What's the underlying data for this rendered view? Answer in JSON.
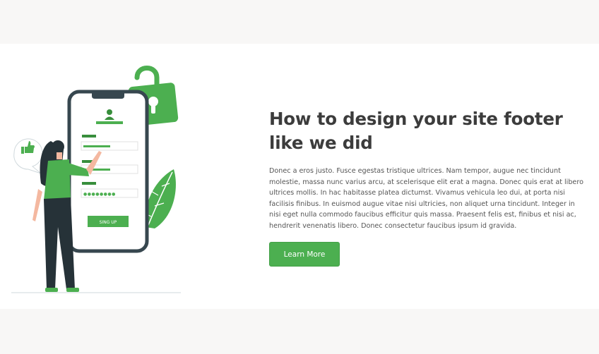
{
  "colors": {
    "accent": "#4caf50",
    "accent_dark": "#388e3c",
    "heading": "#3c3c3c",
    "text": "#555555",
    "page_bg": "#f8f7f6",
    "section_bg": "#ffffff",
    "phone_frame": "#37474f"
  },
  "illustration": {
    "icons": [
      "padlock-icon",
      "thumbs-up-icon",
      "user-icon",
      "leaf-icon",
      "pointing-woman"
    ],
    "phone_button_label": "SING UP",
    "password_mask": "●●●●●●●●"
  },
  "content": {
    "title": "How to design your site footer like we did",
    "body": "Donec a eros justo. Fusce egestas tristique ultrices. Nam tempor, augue nec tincidunt molestie, massa nunc varius arcu, at scelerisque elit erat a magna. Donec quis erat at libero ultrices mollis. In hac habitasse platea dictumst. Vivamus vehicula leo dui, at porta nisi facilisis finibus. In euismod augue vitae nisi ultricies, non aliquet urna tincidunt. Integer in nisi eget nulla commodo faucibus efficitur quis massa. Praesent felis est, finibus et nisi ac, hendrerit venenatis libero. Donec consectetur faucibus ipsum id gravida.",
    "button_label": "Learn More"
  }
}
